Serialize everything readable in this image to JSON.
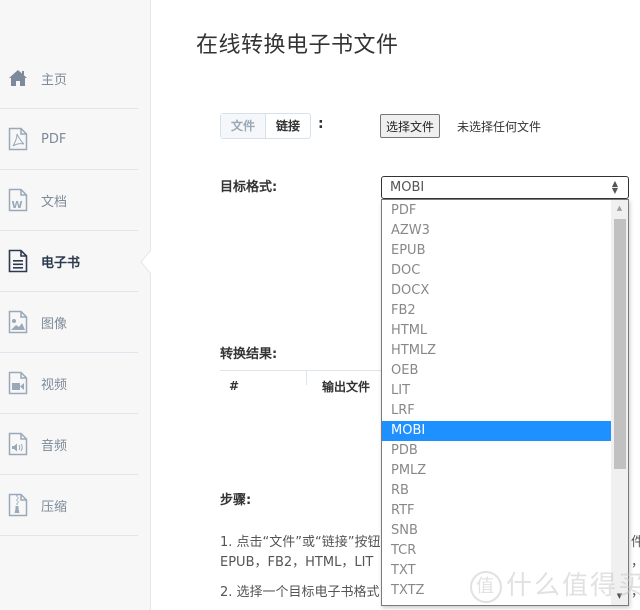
{
  "sidebar": {
    "items": [
      {
        "label": "主页",
        "icon": "home-icon",
        "active": false
      },
      {
        "label": "PDF",
        "icon": "pdf-file-icon",
        "active": false
      },
      {
        "label": "文档",
        "icon": "word-file-icon",
        "active": false
      },
      {
        "label": "电子书",
        "icon": "ebook-file-icon",
        "active": true
      },
      {
        "label": "图像",
        "icon": "image-file-icon",
        "active": false
      },
      {
        "label": "视频",
        "icon": "video-file-icon",
        "active": false
      },
      {
        "label": "音频",
        "icon": "audio-file-icon",
        "active": false
      },
      {
        "label": "压缩",
        "icon": "zip-file-icon",
        "active": false
      }
    ]
  },
  "main": {
    "title": "在线转换电子书文件",
    "source_tabs": {
      "file_label": "文件",
      "link_label": "链接",
      "colon": ":"
    },
    "file_input": {
      "button_label": "选择文件",
      "status": "未选择任何文件"
    },
    "target_format": {
      "label": "目标格式:",
      "selected": "MOBI",
      "options": [
        "PDF",
        "AZW3",
        "EPUB",
        "DOC",
        "DOCX",
        "FB2",
        "HTML",
        "HTMLZ",
        "OEB",
        "LIT",
        "LRF",
        "MOBI",
        "PDB",
        "PMLZ",
        "RB",
        "RTF",
        "SNB",
        "TCR",
        "TXT",
        "TXTZ"
      ]
    },
    "result": {
      "label": "转换结果:",
      "columns": [
        "#",
        "输出文件"
      ]
    },
    "steps": {
      "label": "步骤:",
      "step1_line1": "1. 点击“文件”或“链接”按钮",
      "step1_line2": "EPUB，FB2，HTML，LIT",
      "step2": "2. 选择一个目标电子书格式",
      "right_fragment1": "件",
      "right_fragment2": "，",
      "right_fragment3": "，"
    }
  },
  "watermark": {
    "circle_char": "值",
    "text": "什么值得买"
  },
  "colors": {
    "selected_option_bg": "#1e90ff",
    "sidebar_bg": "#f7f7f7",
    "active_nav_text": "#2c3a4d",
    "inactive_nav_text": "#7d8a99"
  }
}
